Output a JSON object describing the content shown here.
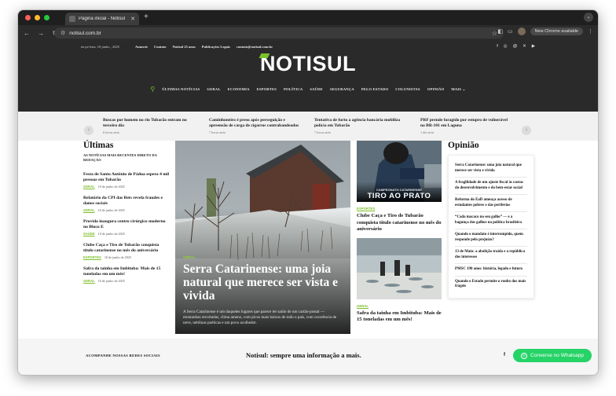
{
  "browser": {
    "tab_title": "Página inicial - Notisul",
    "url": "notisul.com.br",
    "new_chrome_label": "New Chrome available"
  },
  "site": {
    "date": "terça-feira, 10 junho , 2025",
    "top_links": [
      "Anuncie",
      "Contato",
      "Notisul 25 anos",
      "Publicações Legais",
      "contato@notisul.com.br"
    ],
    "social_icons": [
      "facebook-icon",
      "instagram-icon",
      "threads-icon",
      "x-icon",
      "youtube-icon"
    ],
    "social_glyphs": [
      "f",
      "◎",
      "@",
      "✕",
      "▶"
    ],
    "logo": "NOTISUL",
    "nav": [
      "ÚLTIMAS NOTÍCIAS",
      "GERAL",
      "ECONOMIA",
      "ESPORTES",
      "POLÍTICA",
      "SAÚDE",
      "SEGURANÇA",
      "PELO ESTADO",
      "COLUNISTAS",
      "OPINIÃO",
      "MAIS ⌄"
    ]
  },
  "ticker": [
    {
      "headline": "Buscas por homem no rio Tubarão entram no terceiro dia",
      "time": "6 horas atrás"
    },
    {
      "headline": "Caminhoneiro é preso após perseguição e apreensão de carga de cigarros contrabandeados",
      "time": "7 horas atrás"
    },
    {
      "headline": "Tentativa de furto a agência bancária mobiliza polícia em Tubarão",
      "time": "7 horas atrás"
    },
    {
      "headline": "PRF prende foragido por estupro de vulnerável na BR-101 em Laguna",
      "time": "1 dia atrás"
    }
  ],
  "latest": {
    "heading": "Últimas",
    "sub": "AS NOTÍCIAS MAIS RECENTES DIRETO DA REDAÇÃO",
    "items": [
      {
        "headline": "Festa de Santo Antônio de Pádua espera 4 mil pessoas em Tubarão",
        "category": "GERAL",
        "date": "10 de junho de 2025"
      },
      {
        "headline": "Relatório da CPI das Bets revela fraudes e danos sociais",
        "category": "GERAL",
        "date": "10 de junho de 2025"
      },
      {
        "headline": "Provida inaugura centro cirúrgico moderno no Bloco E",
        "category": "SAÚDE",
        "date": "10 de junho de 2025"
      },
      {
        "headline": "Clube Caça e Tiro de Tubarão conquista título catarinense no mês do aniversário",
        "category": "ESPORTES",
        "date": "10 de junho de 2025"
      },
      {
        "headline": "Safra da tainha em Imbituba: Mais de 15 toneladas em um mês!",
        "category": "GERAL",
        "date": "10 de junho de 2025"
      }
    ]
  },
  "hero": {
    "category": "GERAL",
    "headline": "Serra Catarinense: uma joia natural que merece ser vista e vivida",
    "excerpt": "A Serra Catarinense é um daqueles lugares que parece ter saído de um cartão-postal — montanhas recortadas, clima ameno, com picos mais baixos de todo o país, com ocorrência de neve, neblinas poéticas e um povo acolhedor."
  },
  "cards": [
    {
      "category": "ESPORTES",
      "headline": "Clube Caça e Tiro de Tubarão conquista título catarinense no mês do aniversário",
      "image_small": "CAMPEONATO CATARINENSE",
      "image_big": "TIRO AO PRATO"
    },
    {
      "category": "GERAL",
      "headline": "Safra da tainha em Imbituba: Mais de 15 toneladas em um mês!"
    }
  ],
  "opinion": {
    "heading": "Opinião",
    "items": [
      "Serra Catarinense: uma joia natural que merece ser vista e vivida",
      "A fragilidade de um ajuste fiscal às custas do desenvolvimento e do bem-estar social",
      "Reforma do EaD ameaça acesso de estudantes pobres e das periferias",
      "“Cada macaco no seu galho” — e a bagunça dos galhos na política brasileira",
      "Quando o mandato é interrompido, quem responde pelo prejuízo?",
      "13 de Maio: a abolição traída e a república dos interesses",
      "PMSC 190 anos: história, legado e futuro",
      "Quando o Estado permite o roubo dos mais frágeis"
    ]
  },
  "footer": {
    "follow": "ACOMPANHE NOSSAS REDES SOCIAIS",
    "slogan": "Notisul: sempre uma informação a mais.",
    "fb": "f",
    "whatsapp": "Converse no Whatsapp"
  },
  "colors": {
    "accent": "#7bbf2a",
    "header_bg": "#2a2a2a",
    "whatsapp": "#25d366"
  }
}
